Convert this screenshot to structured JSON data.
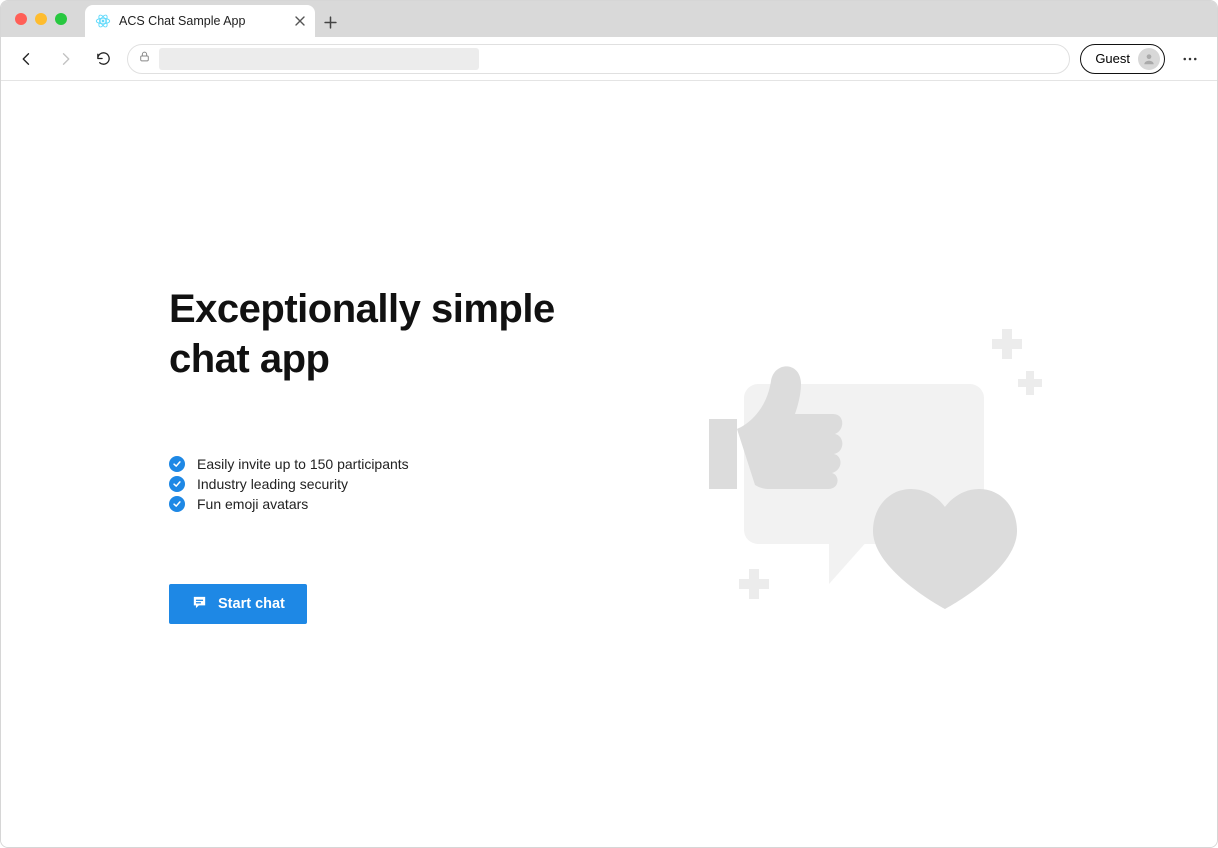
{
  "browser": {
    "tab_title": "ACS Chat Sample App",
    "profile_label": "Guest",
    "address_value": ""
  },
  "page": {
    "headline_line1": "Exceptionally simple",
    "headline_line2": "chat app",
    "features": [
      "Easily invite up to 150 participants",
      "Industry leading security",
      "Fun emoji avatars"
    ],
    "start_button_label": "Start chat"
  }
}
